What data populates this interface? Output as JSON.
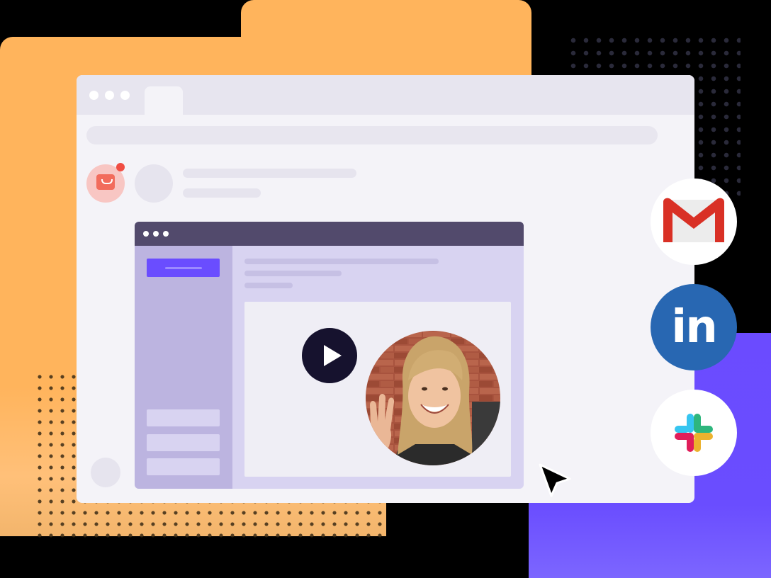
{
  "colors": {
    "orange": "#ffb45c",
    "purple": "#6b4bff",
    "window_bg": "#f4f3f8",
    "inner_bar": "#524a6c",
    "inner_body": "#d8d3f1",
    "notification_red": "#f04d43",
    "linkedin_blue": "#2867b2"
  },
  "apps": [
    {
      "name": "gmail",
      "icon": "gmail-icon"
    },
    {
      "name": "linkedin",
      "icon": "linkedin-icon",
      "label": "in"
    },
    {
      "name": "slack",
      "icon": "slack-icon"
    }
  ],
  "inner_window": {
    "sidebar_items": 3,
    "video": {
      "play_icon": "play-icon",
      "presenter": "presenter-photo"
    }
  },
  "browser": {
    "notification_icon": "mail-icon"
  }
}
